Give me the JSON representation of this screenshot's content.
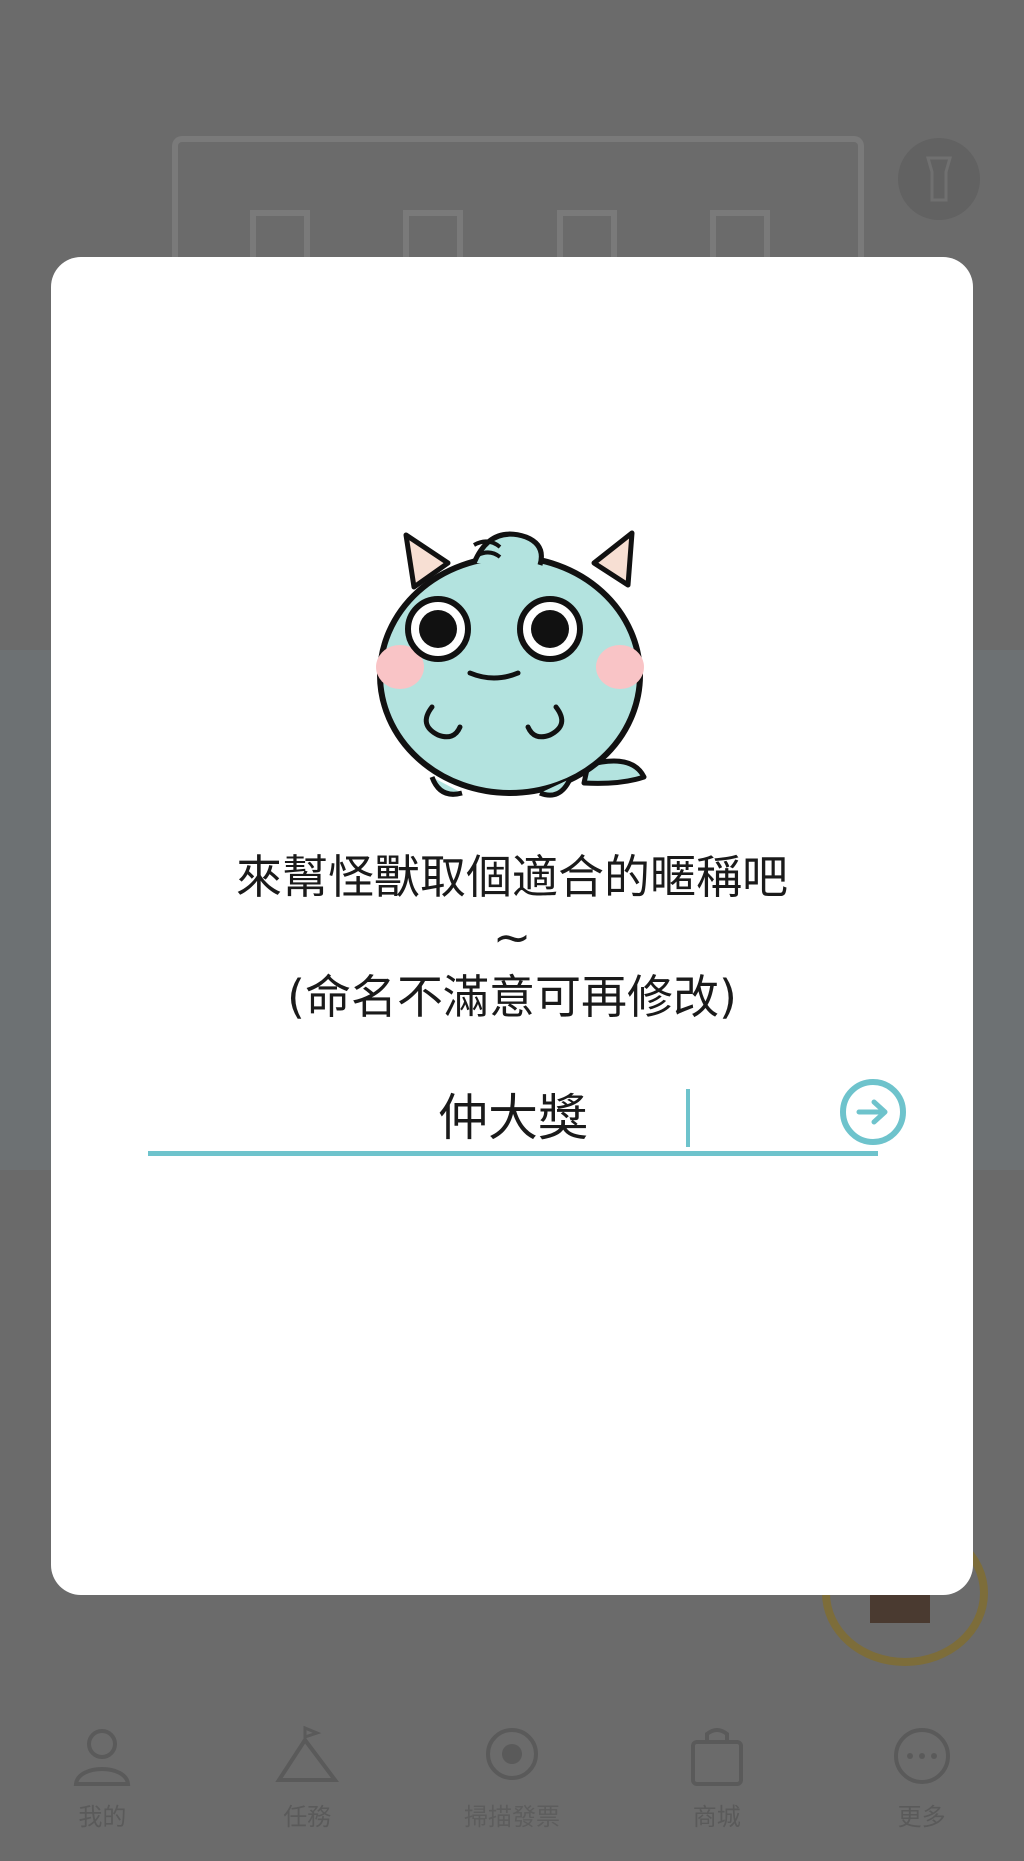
{
  "background": {
    "nav": [
      {
        "label": "我的",
        "icon": "person-icon"
      },
      {
        "label": "任務",
        "icon": "mountain-flag-icon"
      },
      {
        "label": "掃描發票",
        "icon": "scan-icon"
      },
      {
        "label": "商城",
        "icon": "shopping-bag-icon"
      },
      {
        "label": "更多",
        "icon": "more-icon"
      }
    ]
  },
  "dialog": {
    "prompt_line1": "來幫怪獸取個適合的暱稱吧",
    "prompt_line2": "~",
    "prompt_line3": "(命名不滿意可再修改)",
    "name_value": "仲大獎",
    "submit_icon": "arrow-right-circle-icon"
  },
  "colors": {
    "accent": "#6ec3cc",
    "mascot_body": "#b3e3df",
    "mascot_blush": "#f9c4c6",
    "mascot_horn": "#f7dfd3",
    "overlay": "#6b6b6b"
  }
}
